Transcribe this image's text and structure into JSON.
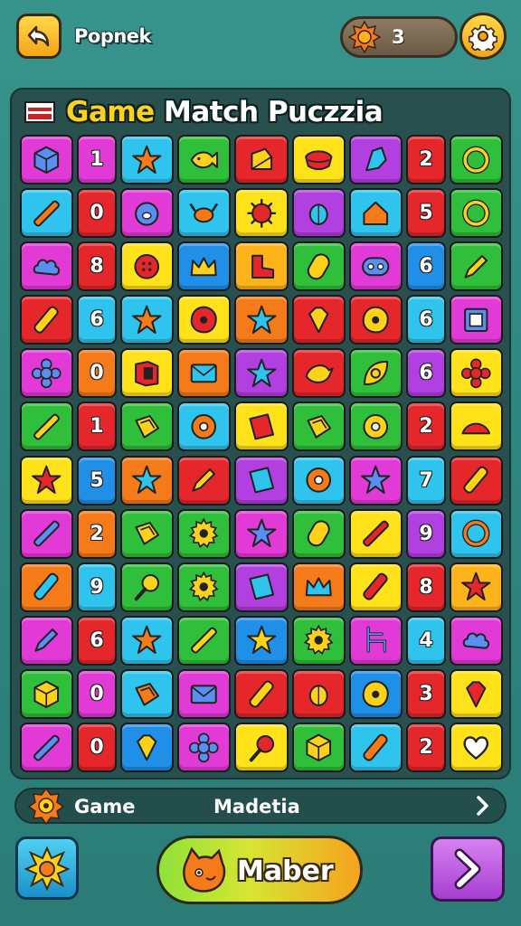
{
  "header": {
    "player_name": "Popnek",
    "coins": "3",
    "back_icon": "back-arrow-icon",
    "settings_icon": "gear-icon",
    "coin_icon": "coin-icon"
  },
  "board": {
    "title_word1": "Game",
    "title_rest": " Match Puczzia",
    "rows": [
      [
        {
          "bg": "#e23ad7",
          "icon": "cube"
        },
        {
          "bg": "#e23ad7",
          "num": "1"
        },
        {
          "bg": "#2fc4ee",
          "icon": "star"
        },
        {
          "bg": "#2fbf3a",
          "icon": "fish"
        },
        {
          "bg": "#e5262b",
          "icon": "note"
        },
        {
          "bg": "#ffe21a",
          "icon": "melon"
        },
        {
          "bg": "#b23fe0",
          "icon": "rocket"
        },
        {
          "bg": "#e5262b",
          "num": "2"
        },
        {
          "bg": "#2fbf3a",
          "icon": "ring"
        }
      ],
      [
        {
          "bg": "#2fc4ee",
          "icon": "pencil"
        },
        {
          "bg": "#e5262b",
          "num": "0"
        },
        {
          "bg": "#e23ad7",
          "icon": "pig"
        },
        {
          "bg": "#2fc4ee",
          "icon": "crab"
        },
        {
          "bg": "#ffe21a",
          "icon": "virus"
        },
        {
          "bg": "#b23fe0",
          "icon": "bug"
        },
        {
          "bg": "#2fc4ee",
          "icon": "house"
        },
        {
          "bg": "#e5262b",
          "num": "5"
        },
        {
          "bg": "#2fbf3a",
          "icon": "ring"
        }
      ],
      [
        {
          "bg": "#e23ad7",
          "icon": "cloud"
        },
        {
          "bg": "#e5262b",
          "num": "8"
        },
        {
          "bg": "#ffe21a",
          "icon": "button"
        },
        {
          "bg": "#1f8fe8",
          "icon": "crown"
        },
        {
          "bg": "#ffb31a",
          "icon": "boot"
        },
        {
          "bg": "#2fbf3a",
          "icon": "capsule"
        },
        {
          "bg": "#e23ad7",
          "icon": "face"
        },
        {
          "bg": "#1f8fe8",
          "num": "6"
        },
        {
          "bg": "#2fbf3a",
          "icon": "pen"
        }
      ],
      [
        {
          "bg": "#e5262b",
          "icon": "bottle"
        },
        {
          "bg": "#2fc4ee",
          "num": "6"
        },
        {
          "bg": "#2fc4ee",
          "icon": "star"
        },
        {
          "bg": "#ffe21a",
          "icon": "blob"
        },
        {
          "bg": "#f57a1a",
          "icon": "star"
        },
        {
          "bg": "#e5262b",
          "icon": "gem"
        },
        {
          "bg": "#e5262b",
          "icon": "blob"
        },
        {
          "bg": "#2fc4ee",
          "num": "6"
        },
        {
          "bg": "#e23ad7",
          "icon": "frame"
        }
      ],
      [
        {
          "bg": "#e23ad7",
          "icon": "flower"
        },
        {
          "bg": "#f57a1a",
          "num": "0"
        },
        {
          "bg": "#ffe21a",
          "icon": "book"
        },
        {
          "bg": "#f57a1a",
          "icon": "mail"
        },
        {
          "bg": "#b23fe0",
          "icon": "star"
        },
        {
          "bg": "#e5262b",
          "icon": "bird"
        },
        {
          "bg": "#2fbf3a",
          "icon": "leaf"
        },
        {
          "bg": "#b23fe0",
          "num": "6"
        },
        {
          "bg": "#ffe21a",
          "icon": "flower"
        }
      ],
      [
        {
          "bg": "#2fbf3a",
          "icon": "pencil"
        },
        {
          "bg": "#e5262b",
          "num": "1"
        },
        {
          "bg": "#2fbf3a",
          "icon": "box"
        },
        {
          "bg": "#2fc4ee",
          "icon": "donut"
        },
        {
          "bg": "#ffe21a",
          "icon": "paper"
        },
        {
          "bg": "#2fbf3a",
          "icon": "box"
        },
        {
          "bg": "#2fbf3a",
          "icon": "donut"
        },
        {
          "bg": "#e5262b",
          "num": "2"
        },
        {
          "bg": "#ffe21a",
          "icon": "hat"
        }
      ],
      [
        {
          "bg": "#ffe21a",
          "icon": "star"
        },
        {
          "bg": "#1f8fe8",
          "num": "5"
        },
        {
          "bg": "#f57a1a",
          "icon": "star"
        },
        {
          "bg": "#e5262b",
          "icon": "pen"
        },
        {
          "bg": "#b23fe0",
          "icon": "paper"
        },
        {
          "bg": "#2fc4ee",
          "icon": "donut"
        },
        {
          "bg": "#e23ad7",
          "icon": "star"
        },
        {
          "bg": "#2fc4ee",
          "num": "7"
        },
        {
          "bg": "#e5262b",
          "icon": "bottle"
        }
      ],
      [
        {
          "bg": "#e23ad7",
          "icon": "pencil"
        },
        {
          "bg": "#f57a1a",
          "num": "2"
        },
        {
          "bg": "#2fbf3a",
          "icon": "box"
        },
        {
          "bg": "#2fbf3a",
          "icon": "gear"
        },
        {
          "bg": "#e23ad7",
          "icon": "star"
        },
        {
          "bg": "#2fbf3a",
          "icon": "capsule"
        },
        {
          "bg": "#ffe21a",
          "icon": "pencil"
        },
        {
          "bg": "#b23fe0",
          "num": "9"
        },
        {
          "bg": "#2fc4ee",
          "icon": "ring"
        }
      ],
      [
        {
          "bg": "#f57a1a",
          "icon": "bottle"
        },
        {
          "bg": "#2fc4ee",
          "num": "9"
        },
        {
          "bg": "#2fbf3a",
          "icon": "racket"
        },
        {
          "bg": "#2fbf3a",
          "icon": "gear"
        },
        {
          "bg": "#b23fe0",
          "icon": "paper"
        },
        {
          "bg": "#f57a1a",
          "icon": "crown"
        },
        {
          "bg": "#ffe21a",
          "icon": "bottle"
        },
        {
          "bg": "#e5262b",
          "num": "8"
        },
        {
          "bg": "#ffb31a",
          "icon": "star"
        }
      ],
      [
        {
          "bg": "#e23ad7",
          "icon": "pen"
        },
        {
          "bg": "#e5262b",
          "num": "6"
        },
        {
          "bg": "#2fc4ee",
          "icon": "star"
        },
        {
          "bg": "#2fbf3a",
          "icon": "pencil"
        },
        {
          "bg": "#1f8fe8",
          "icon": "star"
        },
        {
          "bg": "#2fbf3a",
          "icon": "gear"
        },
        {
          "bg": "#e23ad7",
          "icon": "chair"
        },
        {
          "bg": "#2fc4ee",
          "num": "4"
        },
        {
          "bg": "#e23ad7",
          "icon": "cloud"
        }
      ],
      [
        {
          "bg": "#2fbf3a",
          "icon": "cube"
        },
        {
          "bg": "#e23ad7",
          "num": "0"
        },
        {
          "bg": "#2fc4ee",
          "icon": "box"
        },
        {
          "bg": "#e23ad7",
          "icon": "mail"
        },
        {
          "bg": "#e5262b",
          "icon": "bottle"
        },
        {
          "bg": "#e5262b",
          "icon": "bug"
        },
        {
          "bg": "#1f8fe8",
          "icon": "blob"
        },
        {
          "bg": "#e5262b",
          "num": "3"
        },
        {
          "bg": "#ffe21a",
          "icon": "gem"
        }
      ],
      [
        {
          "bg": "#e23ad7",
          "icon": "pencil"
        },
        {
          "bg": "#e5262b",
          "num": "0"
        },
        {
          "bg": "#1f8fe8",
          "icon": "gem"
        },
        {
          "bg": "#e23ad7",
          "icon": "flower"
        },
        {
          "bg": "#ffe21a",
          "icon": "racket"
        },
        {
          "bg": "#2fbf3a",
          "icon": "cube"
        },
        {
          "bg": "#2fc4ee",
          "icon": "bottle"
        },
        {
          "bg": "#e5262b",
          "num": "2"
        },
        {
          "bg": "#ffe21a",
          "icon": "heart"
        }
      ]
    ]
  },
  "info_bar": {
    "left_label": "Game",
    "mid_label": "Madetia",
    "icon": "orange-badge-icon",
    "chevron_icon": "chevron-right-icon"
  },
  "bottom": {
    "left_icon": "powerup-icon",
    "main_label": "Maber",
    "main_icon": "cat-face-icon",
    "right_icon": "arrow-right-icon"
  }
}
